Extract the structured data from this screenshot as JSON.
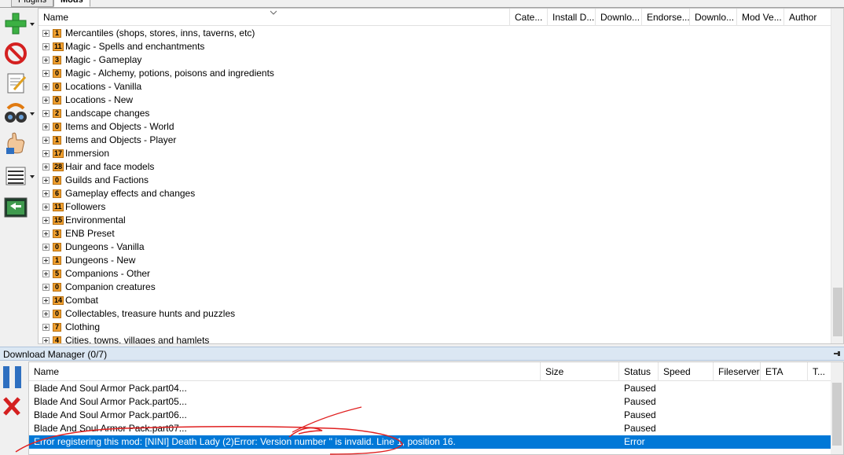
{
  "tabs": [
    {
      "label": "Plugins",
      "active": false
    },
    {
      "label": "Mods",
      "active": true
    }
  ],
  "toolbar": {
    "icons": [
      "add-mod-icon",
      "remove-mod-icon",
      "edit-notes-icon",
      "nexus-search-icon",
      "endorse-hand-icon",
      "list-options-icon",
      "refresh-screen-icon"
    ]
  },
  "mod_list": {
    "columns": [
      "Name",
      "Cate...",
      "Install D...",
      "Downlo...",
      "Endorse...",
      "Downlo...",
      "Mod Ve...",
      "Author"
    ],
    "categories": [
      {
        "count": "1",
        "label": "Mercantiles (shops, stores, inns, taverns, etc)"
      },
      {
        "count": "11",
        "label": "Magic - Spells and enchantments"
      },
      {
        "count": "3",
        "label": "Magic - Gameplay"
      },
      {
        "count": "0",
        "label": "Magic - Alchemy, potions, poisons and ingredients"
      },
      {
        "count": "0",
        "label": "Locations - Vanilla"
      },
      {
        "count": "0",
        "label": "Locations - New"
      },
      {
        "count": "2",
        "label": "Landscape changes"
      },
      {
        "count": "0",
        "label": "Items and Objects - World"
      },
      {
        "count": "1",
        "label": "Items and Objects - Player"
      },
      {
        "count": "17",
        "label": "Immersion"
      },
      {
        "count": "28",
        "label": "Hair and face models"
      },
      {
        "count": "0",
        "label": "Guilds and Factions"
      },
      {
        "count": "6",
        "label": "Gameplay effects and changes"
      },
      {
        "count": "11",
        "label": "Followers"
      },
      {
        "count": "15",
        "label": "Environmental"
      },
      {
        "count": "3",
        "label": "ENB Preset"
      },
      {
        "count": "0",
        "label": "Dungeons - Vanilla"
      },
      {
        "count": "1",
        "label": "Dungeons - New"
      },
      {
        "count": "5",
        "label": "Companions - Other"
      },
      {
        "count": "0",
        "label": "Companion creatures"
      },
      {
        "count": "14",
        "label": "Combat"
      },
      {
        "count": "0",
        "label": "Collectables, treasure hunts and puzzles"
      },
      {
        "count": "7",
        "label": "Clothing"
      },
      {
        "count": "4",
        "label": "Cities, towns, villages and hamlets"
      }
    ]
  },
  "download_manager": {
    "title": "Download Manager (0/7)",
    "columns": [
      "Name",
      "Size",
      "Status",
      "Speed",
      "Fileserver",
      "ETA",
      "T..."
    ],
    "rows": [
      {
        "name": "Blade And Soul Armor Pack.part04...",
        "status": "Paused",
        "selected": false
      },
      {
        "name": "Blade And Soul Armor Pack.part05...",
        "status": "Paused",
        "selected": false
      },
      {
        "name": "Blade And Soul Armor Pack.part06...",
        "status": "Paused",
        "selected": false
      },
      {
        "name": "Blade And Soul Armor Pack.part07...",
        "status": "Paused",
        "selected": false
      },
      {
        "name": "Error registering this mod: [NINI] Death Lady (2)Error: Version number '' is invalid. Line 1, position 16.",
        "status": "Error",
        "selected": true
      }
    ]
  },
  "colors": {
    "selection": "#0078d7",
    "badge": "#f0a030",
    "annotation": "#e02020",
    "panel_bar": "#dbe7f3"
  }
}
